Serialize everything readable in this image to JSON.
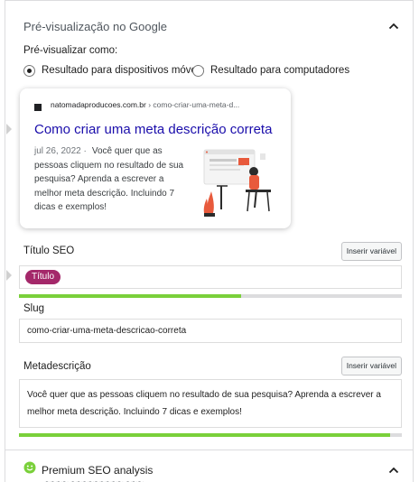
{
  "panel": {
    "title": "Pré-visualização no Google"
  },
  "preview": {
    "label": "Pré-visualizar como:",
    "mobile_option": "Resultado para dispositivos móveis",
    "desktop_option": "Resultado para computadores",
    "selected": "mobile"
  },
  "snippet": {
    "site": "natomadaproducoes.com.br",
    "path": " › como-criar-uma-meta-d...",
    "title": "Como criar uma meta descrição correta",
    "date": "jul 26, 2022 ·",
    "description": "Você quer que as pessoas cliquem no resultado de sua pesquisa? Aprenda a escrever a melhor meta descrição. Incluindo 7 dicas e exemplos!"
  },
  "seo_title": {
    "label": "Título SEO",
    "insert_variable": "Inserir variável",
    "pill": "Título",
    "progress": 0.58
  },
  "slug": {
    "label": "Slug",
    "value": "como-criar-uma-meta-descricao-correta"
  },
  "meta_description": {
    "label": "Metadescrição",
    "insert_variable": "Inserir variável",
    "value": "Você quer que as pessoas cliquem no resultado de sua pesquisa? Aprenda a escrever a melhor meta descrição. Incluindo 7 dicas e exemplos!",
    "progress": 0.97
  },
  "premium": {
    "title": "Premium SEO analysis",
    "cut_text": "~~~~ ~~~~~~~~~ ~~~"
  },
  "colors": {
    "link_blue": "#1a0dab",
    "pill_magenta": "#a4286a",
    "progress_green": "#7ad03a",
    "smile_green": "#7ad03a"
  },
  "icons": {
    "collapse": "chevron-up-icon",
    "status": "smiley-icon",
    "favicon": "favicon-icon"
  }
}
